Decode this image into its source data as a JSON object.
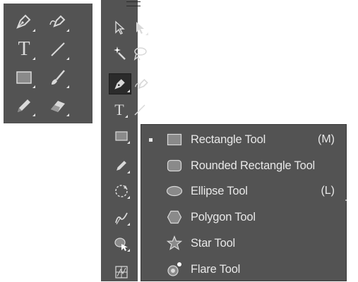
{
  "colors": {
    "panel_bg": "#535353",
    "icon": "#d9d9d9",
    "active_bg": "#2b2b2b",
    "text": "#e8e8e8"
  },
  "left_panel": {
    "tools": [
      {
        "icon": "pen-icon"
      },
      {
        "icon": "curvature-pen-icon"
      },
      {
        "icon": "type-icon",
        "glyph": "T"
      },
      {
        "icon": "line-segment-icon"
      },
      {
        "icon": "rectangle-icon"
      },
      {
        "icon": "paintbrush-icon"
      },
      {
        "icon": "pencil-icon"
      },
      {
        "icon": "eraser-icon"
      }
    ]
  },
  "main_toolbar": {
    "tools": [
      {
        "icon": "selection-icon"
      },
      {
        "icon": "direct-selection-icon"
      },
      {
        "icon": "magic-wand-icon"
      },
      {
        "icon": "lasso-icon"
      },
      {
        "icon": "pen-icon"
      },
      {
        "icon": "curvature-pen-icon"
      },
      {
        "icon": "type-icon",
        "glyph": "T"
      },
      {
        "icon": "line-segment-icon"
      },
      {
        "icon": "rectangle-icon"
      },
      {
        "icon": "pencil-icon"
      },
      {
        "icon": "rotate-icon"
      },
      {
        "icon": "warp-icon"
      },
      {
        "icon": "shape-builder-icon"
      },
      {
        "icon": "graph-icon"
      }
    ]
  },
  "flyout": {
    "items": [
      {
        "label": "Rectangle Tool",
        "shortcut": "(M)",
        "icon": "rectangle-icon",
        "selected": true
      },
      {
        "label": "Rounded Rectangle Tool",
        "shortcut": "",
        "icon": "rounded-rectangle-icon",
        "selected": false
      },
      {
        "label": "Ellipse Tool",
        "shortcut": "(L)",
        "icon": "ellipse-icon",
        "selected": false
      },
      {
        "label": "Polygon Tool",
        "shortcut": "",
        "icon": "polygon-icon",
        "selected": false
      },
      {
        "label": "Star Tool",
        "shortcut": "",
        "icon": "star-icon",
        "selected": false
      },
      {
        "label": "Flare Tool",
        "shortcut": "",
        "icon": "flare-icon",
        "selected": false
      }
    ]
  }
}
